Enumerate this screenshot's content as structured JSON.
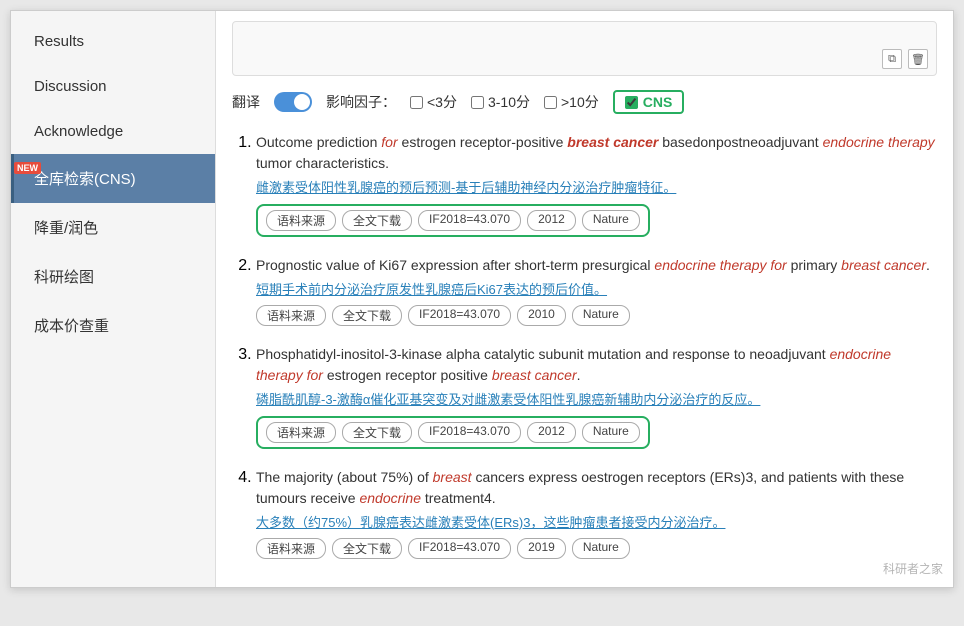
{
  "sidebar": {
    "items": [
      {
        "id": "results",
        "label": "Results",
        "active": false
      },
      {
        "id": "discussion",
        "label": "Discussion",
        "active": false
      },
      {
        "id": "acknowledge",
        "label": "Acknowledge",
        "active": false
      },
      {
        "id": "cns-search",
        "label": "全库检索(CNS)",
        "active": true,
        "badge": "NEW"
      },
      {
        "id": "recolor",
        "label": "降重/润色",
        "active": false
      },
      {
        "id": "sci-drawing",
        "label": "科研绘图",
        "active": false
      },
      {
        "id": "cost-check",
        "label": "成本价查重",
        "active": false
      }
    ]
  },
  "toolbar": {
    "copy_icon": "⧉",
    "delete_icon": "🗑"
  },
  "filter": {
    "translate_label": "翻译",
    "impact_label": "影响因子：",
    "opt1_label": "<3分",
    "opt2_label": "3-10分",
    "opt3_label": ">10分",
    "cns_label": "CNS"
  },
  "results": [
    {
      "id": 1,
      "title_plain": "Outcome prediction ",
      "title_parts": [
        {
          "text": "Outcome prediction ",
          "style": "normal"
        },
        {
          "text": "for",
          "style": "red-italic"
        },
        {
          "text": " estrogen receptor-positive ",
          "style": "normal"
        },
        {
          "text": "breast cancer",
          "style": "red-bold-italic"
        },
        {
          "text": " basedonpostneoadjuvant ",
          "style": "normal"
        },
        {
          "text": "endocrine therapy",
          "style": "red-italic"
        },
        {
          "text": " tumor characteristics.",
          "style": "normal"
        }
      ],
      "translation": "雌激素受体阳性乳腺癌的预后预测-基于后辅助神经内分泌治疗肿瘤特征。",
      "tags": [
        "语料来源",
        "全文下载",
        "IF2018=43.070",
        "2012",
        "Nature"
      ],
      "tags_highlighted": true
    },
    {
      "id": 2,
      "title_parts": [
        {
          "text": "Prognostic value of Ki67 expression after short-term presurgical ",
          "style": "normal"
        },
        {
          "text": "endocrine therapy for",
          "style": "red-italic"
        },
        {
          "text": " primary ",
          "style": "normal"
        },
        {
          "text": "breast cancer",
          "style": "red-italic"
        },
        {
          "text": ".",
          "style": "normal"
        }
      ],
      "translation": "短期手术前内分泌治疗原发性乳腺癌后Ki67表达的预后价值。",
      "tags": [
        "语料来源",
        "全文下载",
        "IF2018=43.070",
        "2010",
        "Nature"
      ],
      "tags_highlighted": false
    },
    {
      "id": 3,
      "title_parts": [
        {
          "text": "Phosphatidyl-inositol-3-kinase alpha catalytic subunit mutation and response to neoadjuvant ",
          "style": "normal"
        },
        {
          "text": "endocrine therapy for",
          "style": "red-italic"
        },
        {
          "text": " estrogen receptor positive ",
          "style": "normal"
        },
        {
          "text": "breast cancer",
          "style": "red-italic"
        },
        {
          "text": ".",
          "style": "normal"
        }
      ],
      "translation": "磷脂酰肌醇-3-激酶α催化亚基突变及对雌激素受体阳性乳腺癌新辅助内分泌治疗的反应。",
      "tags": [
        "语料来源",
        "全文下载",
        "IF2018=43.070",
        "2012",
        "Nature"
      ],
      "tags_highlighted": true
    },
    {
      "id": 4,
      "title_parts": [
        {
          "text": "The majority (about 75%) of ",
          "style": "normal"
        },
        {
          "text": "breast",
          "style": "red-italic"
        },
        {
          "text": " cancers express oestrogen receptors (ERs)3, and patients with these tumours receive ",
          "style": "normal"
        },
        {
          "text": "endocrine",
          "style": "red-italic"
        },
        {
          "text": " treatment4.",
          "style": "normal"
        }
      ],
      "translation": "大多数（约75%）乳腺癌表达雌激素受体(ERs)3，这些肿瘤患者接受内分泌治疗。",
      "tags": [
        "语料来源",
        "全文下载",
        "IF2018=43.070",
        "2019",
        "Nature"
      ],
      "tags_highlighted": false
    }
  ],
  "watermark": "科研者之家"
}
